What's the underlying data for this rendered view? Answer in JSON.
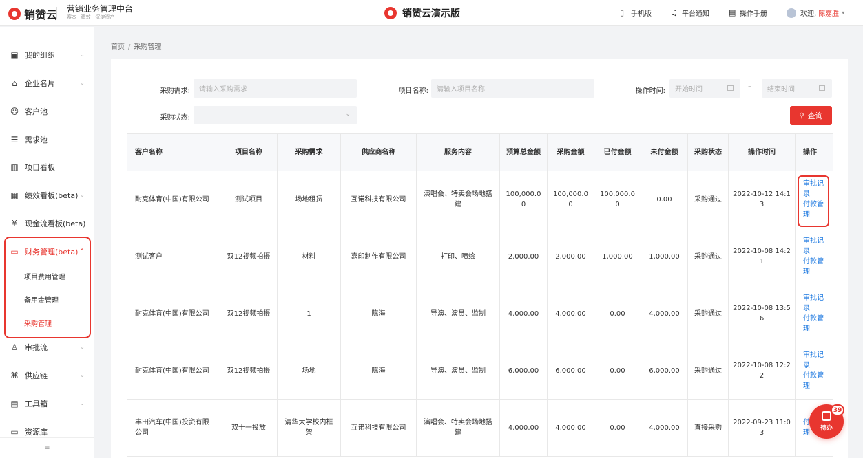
{
  "header": {
    "brand": "销赞云",
    "platform_title": "营销业务管理中台",
    "platform_sub": "赛本 · 建效 · 沉淀资产",
    "center_title": "销赞云演示版",
    "actions": [
      {
        "label": "手机版",
        "icon": "mobile-icon"
      },
      {
        "label": "平台通知",
        "icon": "bell-icon"
      },
      {
        "label": "操作手册",
        "icon": "book-icon"
      }
    ],
    "welcome": "欢迎,",
    "username": "陈嘉胜"
  },
  "sidebar": {
    "items": [
      {
        "label": "我的组织",
        "icon": "org-icon"
      },
      {
        "label": "企业名片",
        "icon": "building-icon"
      },
      {
        "label": "客户池",
        "icon": "user-icon"
      },
      {
        "label": "需求池",
        "icon": "list-icon"
      },
      {
        "label": "项目看板",
        "icon": "board-icon"
      },
      {
        "label": "绩效看板(beta)",
        "icon": "chart-icon"
      },
      {
        "label": "现金流看板(beta)",
        "icon": "cash-icon"
      },
      {
        "label": "财务管理(beta)",
        "icon": "wallet-icon"
      },
      {
        "label": "审批流",
        "icon": "stamp-icon"
      },
      {
        "label": "供应链",
        "icon": "chain-icon"
      },
      {
        "label": "工具箱",
        "icon": "toolbox-icon"
      },
      {
        "label": "资源库",
        "icon": "folder-icon"
      }
    ],
    "sub_items": [
      "项目费用管理",
      "备用金管理",
      "采购管理"
    ],
    "footer": "≡"
  },
  "breadcrumb": {
    "home": "首页",
    "sep": "/",
    "current": "采购管理"
  },
  "filters": {
    "demand_label": "采购需求:",
    "demand_placeholder": "请输入采购需求",
    "project_label": "项目名称:",
    "project_placeholder": "请输入项目名称",
    "time_label": "操作时间:",
    "start_placeholder": "开始时间",
    "end_placeholder": "结束时间",
    "dash": "–",
    "status_label": "采购状态:",
    "query_button": "查询"
  },
  "table": {
    "headers": [
      "客户名称",
      "项目名称",
      "采购需求",
      "供应商名称",
      "服务内容",
      "预算总金额",
      "采购金额",
      "已付金额",
      "未付金额",
      "采购状态",
      "操作时间",
      "操作"
    ],
    "rows": [
      [
        "耐克体育(中国)有限公司",
        "测试项目",
        "场地租赁",
        "互诺科技有限公司",
        "演唱会、特卖会场地搭建",
        "100,000.00",
        "100,000.00",
        "100,000.00",
        "0.00",
        "采购通过",
        "2022-10-12 14:13"
      ],
      [
        "测试客户",
        "双12视频拍摄",
        "材料",
        "嘉印制作有限公司",
        "打印、喷绘",
        "2,000.00",
        "2,000.00",
        "1,000.00",
        "1,000.00",
        "采购通过",
        "2022-10-08 14:21"
      ],
      [
        "耐克体育(中国)有限公司",
        "双12视频拍摄",
        "1",
        "陈海",
        "导演、演员、监制",
        "4,000.00",
        "4,000.00",
        "0.00",
        "4,000.00",
        "采购通过",
        "2022-10-08 13:56"
      ],
      [
        "耐克体育(中国)有限公司",
        "双12视频拍摄",
        "场地",
        "陈海",
        "导演、演员、监制",
        "6,000.00",
        "6,000.00",
        "0.00",
        "6,000.00",
        "采购通过",
        "2022-10-08 12:22"
      ],
      [
        "丰田汽车(中国)投资有限公司",
        "双十一投放",
        "清华大学校内框架",
        "互诺科技有限公司",
        "演唱会、特卖会场地搭建",
        "4,000.00",
        "4,000.00",
        "0.00",
        "4,000.00",
        "直接采购",
        "2022-09-23 11:03"
      ]
    ],
    "op_approve": "审批记录",
    "op_payment": "付款管理"
  },
  "todo": {
    "label": "待办",
    "badge": "39"
  }
}
